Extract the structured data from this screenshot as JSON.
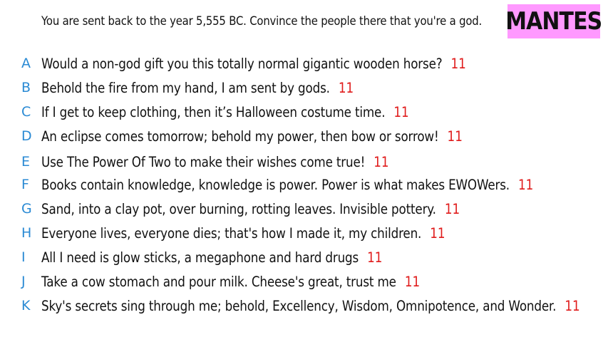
{
  "prompt": "You are sent back to the year 5,555 BC. Convince the people there that you're a god.",
  "badge": "MANTES",
  "colors": {
    "badge_bg": "#ff99ff",
    "letter": "#2a8ad4",
    "score": "#e01b1b"
  },
  "entries": [
    {
      "letter": "A",
      "text": "Would a non-god gift you this totally normal gigantic wooden horse?",
      "score": "11"
    },
    {
      "letter": "B",
      "text": "Behold the fire from my hand, I am sent by gods.",
      "score": "11"
    },
    {
      "letter": "C",
      "text": "If I get to keep clothing, then it’s Halloween costume time.",
      "score": "11"
    },
    {
      "letter": "D",
      "text": "An eclipse comes tomorrow; behold my power, then bow or sorrow!",
      "score": "11"
    },
    {
      "letter": "E",
      "text": "Use The Power Of Two to make their wishes come true!",
      "score": "11"
    },
    {
      "letter": "F",
      "text": "Books contain knowledge, knowledge is power. Power is what makes EWOWers.",
      "score": "11"
    },
    {
      "letter": "G",
      "text": "Sand, into a clay pot, over burning, rotting leaves. Invisible pottery.",
      "score": "11"
    },
    {
      "letter": "H",
      "text": "Everyone lives, everyone dies; that's how I made it, my children.",
      "score": "11"
    },
    {
      "letter": "I",
      "text": "All I need is glow sticks, a megaphone and hard drugs",
      "score": "11"
    },
    {
      "letter": "J",
      "text": "Take a cow stomach and pour milk. Cheese's great, trust me",
      "score": "11"
    },
    {
      "letter": "K",
      "text": "Sky's secrets sing through me; behold, Excellency, Wisdom, Omnipotence, and Wonder.",
      "score": "11"
    }
  ]
}
